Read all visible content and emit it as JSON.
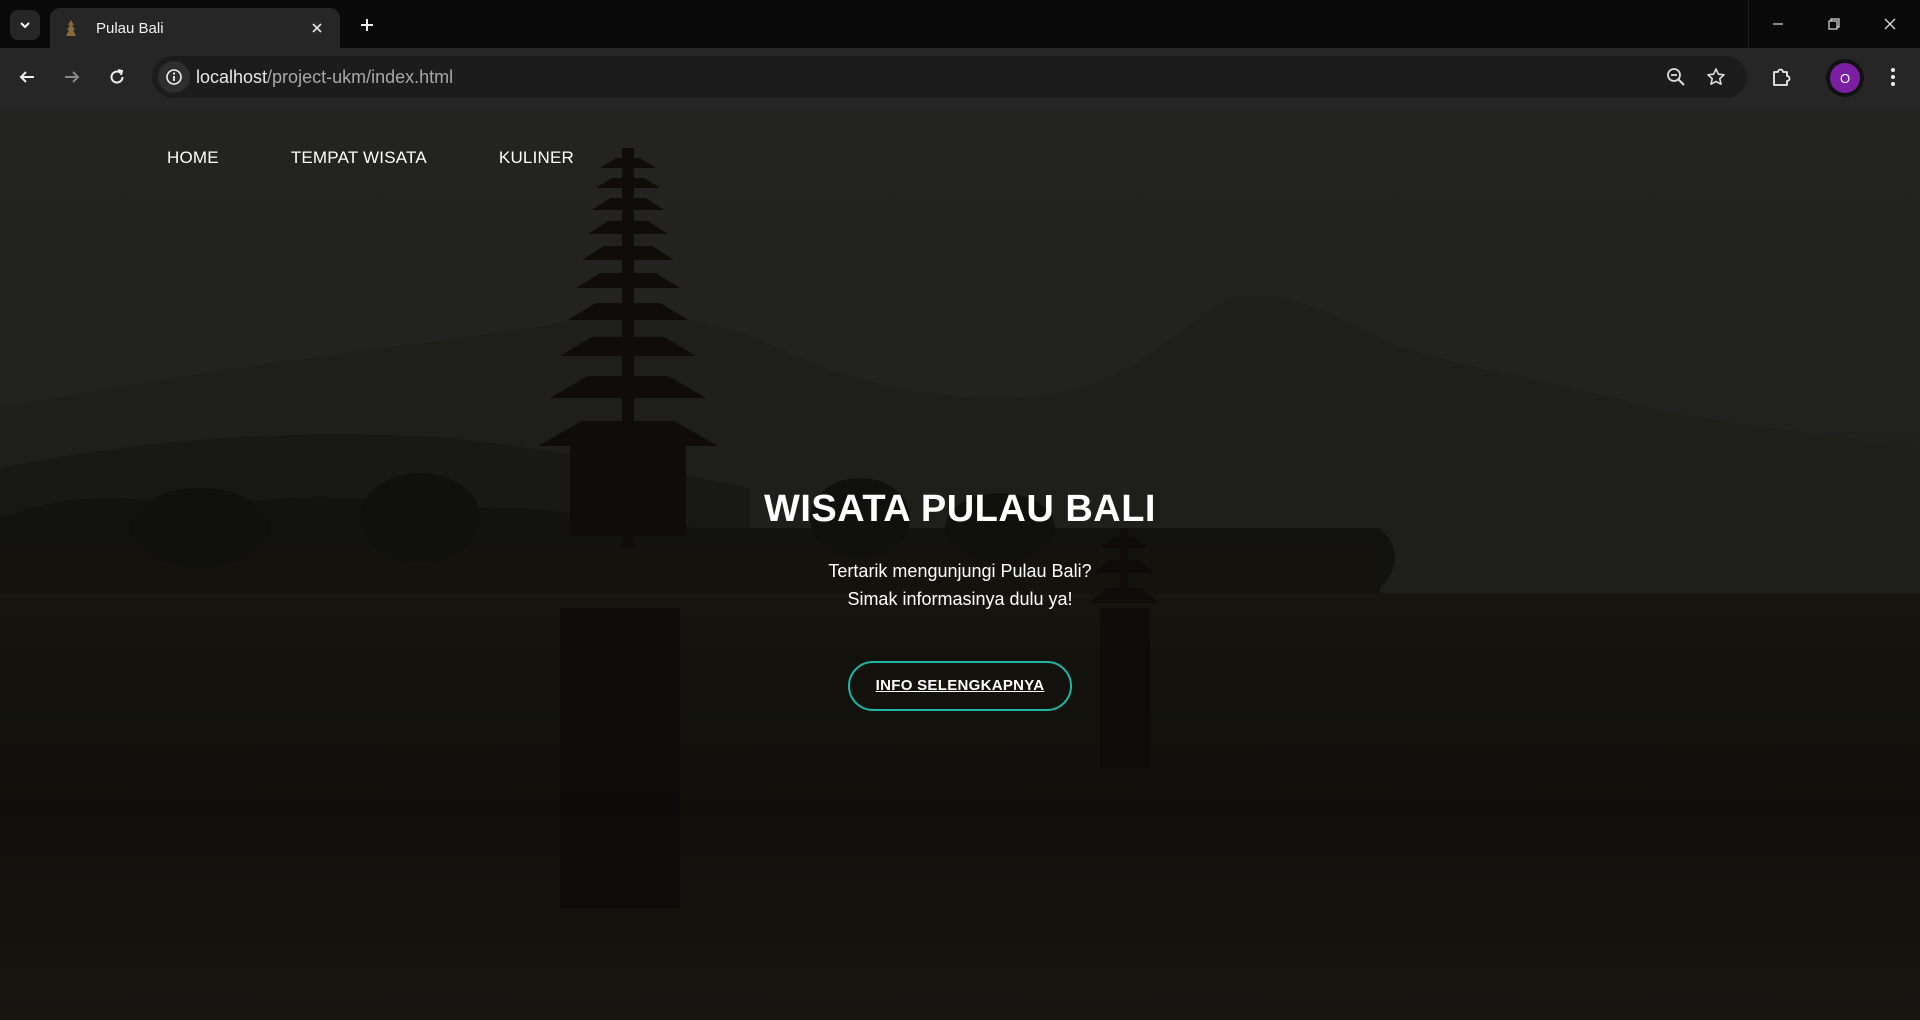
{
  "browser": {
    "tab": {
      "title": "Pulau Bali"
    },
    "address_bar": {
      "host": "localhost",
      "path": "/project-ukm/index.html"
    },
    "profile": {
      "initial": "O",
      "color": "#7b1fa2"
    }
  },
  "icons": {
    "tab_search": "chevron-down-icon",
    "favicon": "temple-favicon-icon",
    "tab_close": "close-icon",
    "new_tab": "plus-icon",
    "back": "arrow-left-icon",
    "forward": "arrow-right-icon",
    "reload": "reload-icon",
    "site_info": "info-icon",
    "zoom": "zoom-out-icon",
    "bookmark": "star-icon",
    "extensions": "puzzle-icon",
    "menu": "kebab-menu-icon",
    "minimize": "minimize-icon",
    "restore": "restore-icon",
    "close_window": "close-icon"
  },
  "page": {
    "nav": [
      "HOME",
      "TEMPAT WISATA",
      "KULINER"
    ],
    "hero": {
      "title": "WISATA PULAU BALI",
      "line1": "Tertarik mengunjungi Pulau Bali?",
      "line2": "Simak informasinya dulu ya!",
      "button": "INFO SELENGKAPNYA"
    },
    "colors": {
      "button_border": "#1fb5a8",
      "text": "#ffffff"
    }
  }
}
